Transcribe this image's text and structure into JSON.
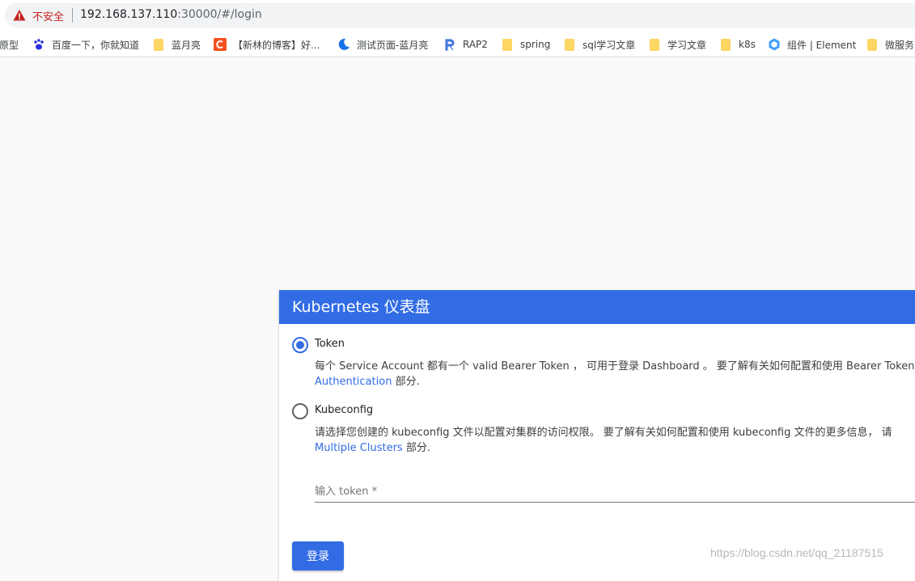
{
  "browser": {
    "security_label": "不安全",
    "url_main": "192.168.137.110",
    "url_rest": ":30000/#/login"
  },
  "bookmarks": [
    {
      "label": "原型",
      "icon": "none"
    },
    {
      "label": "百度一下，你就知道",
      "icon": "baidu-paw-icon"
    },
    {
      "label": "蓝月亮",
      "icon": "folder-icon"
    },
    {
      "label": "【新林的博客】好...",
      "icon": "csdn-icon"
    },
    {
      "label": "测试页面-蓝月亮",
      "icon": "moon-icon"
    },
    {
      "label": "RAP2",
      "icon": "rap2-icon"
    },
    {
      "label": "spring",
      "icon": "folder-icon"
    },
    {
      "label": "sql学习文章",
      "icon": "folder-icon"
    },
    {
      "label": "学习文章",
      "icon": "folder-icon"
    },
    {
      "label": "k8s",
      "icon": "folder-icon"
    },
    {
      "label": "组件 | Element",
      "icon": "element-icon"
    },
    {
      "label": "微服务",
      "icon": "folder-icon"
    }
  ],
  "card": {
    "title": "Kubernetes 仪表盘",
    "token_option": {
      "label": "Token",
      "selected": true,
      "desc_line1": "每个 Service Account 都有一个 valid Bearer Token ， 可用于登录 Dashboard 。 要了解有关如何配置和使用 Bearer Token",
      "desc_link": "Authentication",
      "desc_tail": " 部分."
    },
    "kubeconfig_option": {
      "label": "Kubeconfig",
      "selected": false,
      "desc_line1": "请选择您创建的 kubeconfig 文件以配置对集群的访问权限。 要了解有关如何配置和使用 kubeconfig 文件的更多信息， 请",
      "desc_link": "Multiple Clusters",
      "desc_tail": " 部分."
    },
    "token_input_placeholder": "输入 token *",
    "login_button": "登录"
  },
  "watermark": "https://blog.csdn.net/qq_21187515",
  "colors": {
    "accent": "#326ce5",
    "warning": "#c5221f",
    "folder": "#fdd663"
  }
}
